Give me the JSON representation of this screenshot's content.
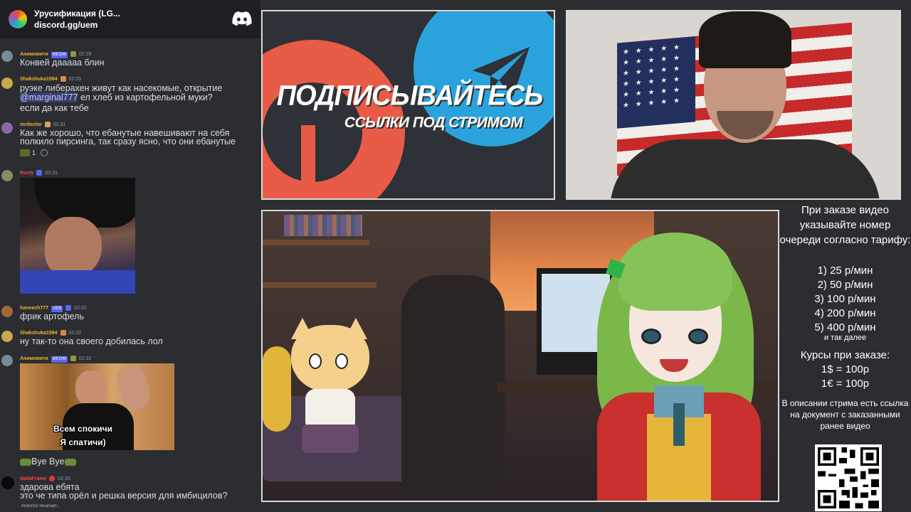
{
  "chat": {
    "server_name": "Урусификация (LG...",
    "invite": "discord.gg/uem",
    "messages": [
      {
        "author": "Анимэмити",
        "badge": "MEOW",
        "time": "02:29",
        "text": "Конвей дааааа блин",
        "color": "#f0b232"
      },
      {
        "author": "Shakshuka1984",
        "time": "02:29",
        "text_lines": [
          "руэке либерахен живут как насекомые, открытие",
          "ел хлеб из картофельной муки?",
          "если да как тебе"
        ],
        "mention": "@marginal777",
        "color": "#f0b232"
      },
      {
        "author": "mrdoctor",
        "time": "02:31",
        "text_lines": [
          "Как же хорошо, что ебанутые навешивают на себя",
          "полкило пирсинга, так сразу ясно, что они ебанутые"
        ],
        "reaction_count": "1",
        "color": "#f0b232"
      },
      {
        "author": "Rusty",
        "time": "02:31",
        "color": "#f04747"
      },
      {
        "author": "haneech777",
        "badge": "UEB",
        "time": "02:32",
        "text": "фрик артофель",
        "color": "#f0b232"
      },
      {
        "author": "Shakshuka1984",
        "time": "02:32",
        "text": "ну так-то она своего добилась лол",
        "color": "#f0b232"
      },
      {
        "author": "Анимэмити",
        "badge": "MEOW",
        "time": "02:32",
        "meme_line1": "Всем спокичи",
        "meme_line2": "Я спатичи)",
        "after": "Bye Bye",
        "color": "#f0b232"
      },
      {
        "author": "dadaFrame",
        "time": "02:33",
        "text_lines": [
          "здарова ебята",
          "это че типа орёл и решка версия для имбицилов?"
        ],
        "color": "#f04747"
      }
    ],
    "typing": "mrdoctor печатает..."
  },
  "promo": {
    "headline": "ПОДПИСЫВАЙТЕСЬ",
    "subline": "ССЫЛКИ ПОД СТРИМОМ"
  },
  "info": {
    "lead": "При заказе видео указывайте номер очереди согласно тарифу:",
    "tiers": [
      "1) 25 р/мин",
      "2) 50 р/мин",
      "3) 100 р/мин",
      "4) 200 р/мин",
      "5) 400 р/мин"
    ],
    "etc": "и так далее",
    "rates_title": "Курсы при заказе:",
    "rates": [
      "1$ = 100р",
      "1€ = 100р"
    ],
    "desc": "В описании стрима есть ссылка на документ с заказанными ранее видео"
  }
}
